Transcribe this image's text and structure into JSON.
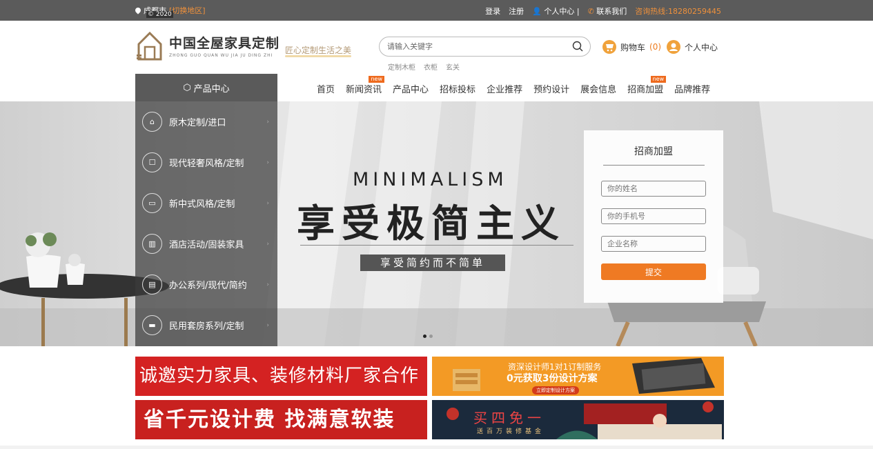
{
  "topbar": {
    "city": "成都市",
    "switch_region": "[切换地区]",
    "year": "© 2020",
    "login": "登录",
    "register": "注册",
    "personal_center": "个人中心",
    "contact_us": "联系我们",
    "hotline": "咨询热线:18280259445"
  },
  "header": {
    "logo_title": "中国全屋家具定制",
    "logo_sub": "ZHONG GUO QUAN WU JIA JU DING ZHI",
    "slogan": "匠心定制生活之美",
    "search_placeholder": "请输入关键字",
    "hotwords": [
      "定制木柜",
      "衣柜",
      "玄关"
    ],
    "cart_label": "购物车",
    "cart_count": "(0)",
    "user_label": "个人中心"
  },
  "nav": {
    "category_head": "产品中心",
    "items": [
      {
        "label": "首页",
        "badge": ""
      },
      {
        "label": "新闻资讯",
        "badge": "new"
      },
      {
        "label": "产品中心",
        "badge": ""
      },
      {
        "label": "招标投标",
        "badge": ""
      },
      {
        "label": "企业推荐",
        "badge": ""
      },
      {
        "label": "预约设计",
        "badge": ""
      },
      {
        "label": "展会信息",
        "badge": ""
      },
      {
        "label": "招商加盟",
        "badge": "new"
      },
      {
        "label": "品牌推荐",
        "badge": ""
      }
    ]
  },
  "categories": [
    {
      "label": "原木定制/进口",
      "icon": "hanger-icon"
    },
    {
      "label": "现代轻奢风格/定制",
      "icon": "sofa-icon"
    },
    {
      "label": "新中式风格/定制",
      "icon": "couch-icon"
    },
    {
      "label": "酒店活动/固装家具",
      "icon": "building-icon"
    },
    {
      "label": "办公系列/现代/简约",
      "icon": "desk-icon"
    },
    {
      "label": "民用套房系列/定制",
      "icon": "bed-icon"
    }
  ],
  "banner": {
    "en_title": "MINIMALISM",
    "cn_title": "享受极简主义",
    "subtitle": "享受简约而不简单"
  },
  "join_form": {
    "title": "招商加盟",
    "name_placeholder": "你的姓名",
    "phone_placeholder": "你的手机号",
    "company_placeholder": "企业名称",
    "submit": "提交"
  },
  "ads": {
    "ad1": "诚邀实力家具、装修材料厂家合作",
    "ad2_line1": "资深设计师1对1订制服务",
    "ad2_line2": "0元获取3份设计方案",
    "ad2_btn": "立即定制设计方案",
    "ad3": "省千元设计费 找满意软装",
    "ad4_title": "买四免一",
    "ad4_sub": "送百万装修基金"
  },
  "colors": {
    "accent_orange": "#ef7a23",
    "topbar_bg": "#5b5b5b",
    "ad_red": "#d42222"
  }
}
